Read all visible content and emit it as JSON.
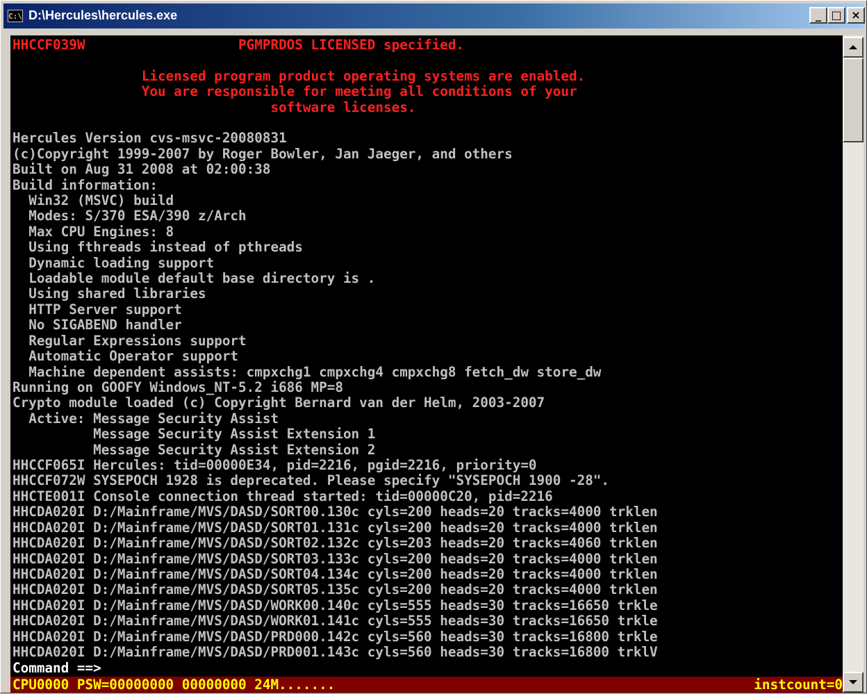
{
  "window": {
    "title": "D:\\Hercules\\hercules.exe",
    "icon": "console-icon",
    "minimize": "_",
    "maximize": "□",
    "close": "×"
  },
  "console": {
    "lines": [
      "HHCCF039W                   PGMPRDOS LICENSED specified.",
      "",
      "                Licensed program product operating systems are enabled.",
      "                You are responsible for meeting all conditions of your",
      "                                software licenses.",
      "",
      "Hercules Version cvs-msvc-20080831",
      "(c)Copyright 1999-2007 by Roger Bowler, Jan Jaeger, and others",
      "Built on Aug 31 2008 at 02:00:38",
      "Build information:",
      "  Win32 (MSVC) build",
      "  Modes: S/370 ESA/390 z/Arch",
      "  Max CPU Engines: 8",
      "  Using fthreads instead of pthreads",
      "  Dynamic loading support",
      "  Loadable module default base directory is .",
      "  Using shared libraries",
      "  HTTP Server support",
      "  No SIGABEND handler",
      "  Regular Expressions support",
      "  Automatic Operator support",
      "  Machine dependent assists: cmpxchg1 cmpxchg4 cmpxchg8 fetch_dw store_dw",
      "Running on GOOFY Windows_NT-5.2 i686 MP=8",
      "Crypto module loaded (c) Copyright Bernard van der Helm, 2003-2007",
      "  Active: Message Security Assist",
      "          Message Security Assist Extension 1",
      "          Message Security Assist Extension 2",
      "HHCCF065I Hercules: tid=00000E34, pid=2216, pgid=2216, priority=0",
      "HHCCF072W SYSEPOCH 1928 is deprecated. Please specify \"SYSEPOCH 1900 -28\".",
      "HHCTE001I Console connection thread started: tid=00000C20, pid=2216",
      "HHCDA020I D:/Mainframe/MVS/DASD/SORT00.130c cyls=200 heads=20 tracks=4000 trklen",
      "HHCDA020I D:/Mainframe/MVS/DASD/SORT01.131c cyls=200 heads=20 tracks=4000 trklen",
      "HHCDA020I D:/Mainframe/MVS/DASD/SORT02.132c cyls=203 heads=20 tracks=4060 trklen",
      "HHCDA020I D:/Mainframe/MVS/DASD/SORT03.133c cyls=200 heads=20 tracks=4000 trklen",
      "HHCDA020I D:/Mainframe/MVS/DASD/SORT04.134c cyls=200 heads=20 tracks=4000 trklen",
      "HHCDA020I D:/Mainframe/MVS/DASD/SORT05.135c cyls=200 heads=20 tracks=4000 trklen",
      "HHCDA020I D:/Mainframe/MVS/DASD/WORK00.140c cyls=555 heads=30 tracks=16650 trkle",
      "HHCDA020I D:/Mainframe/MVS/DASD/WORK01.141c cyls=555 heads=30 tracks=16650 trkle",
      "HHCDA020I D:/Mainframe/MVS/DASD/PRD000.142c cyls=560 heads=30 tracks=16800 trkle",
      "HHCDA020I D:/Mainframe/MVS/DASD/PRD001.143c cyls=560 heads=30 tracks=16800 trklV"
    ],
    "command_prompt": "Command ==>",
    "status_left": "CPU0000 PSW=00000000 00000000 24M.......",
    "status_right": "instcount=0"
  },
  "colors": {
    "console_bg": "#000000",
    "text": "#c0c0c0",
    "license_text": "#ff2020",
    "status_bg": "#800000",
    "status_text": "#ffff00"
  }
}
